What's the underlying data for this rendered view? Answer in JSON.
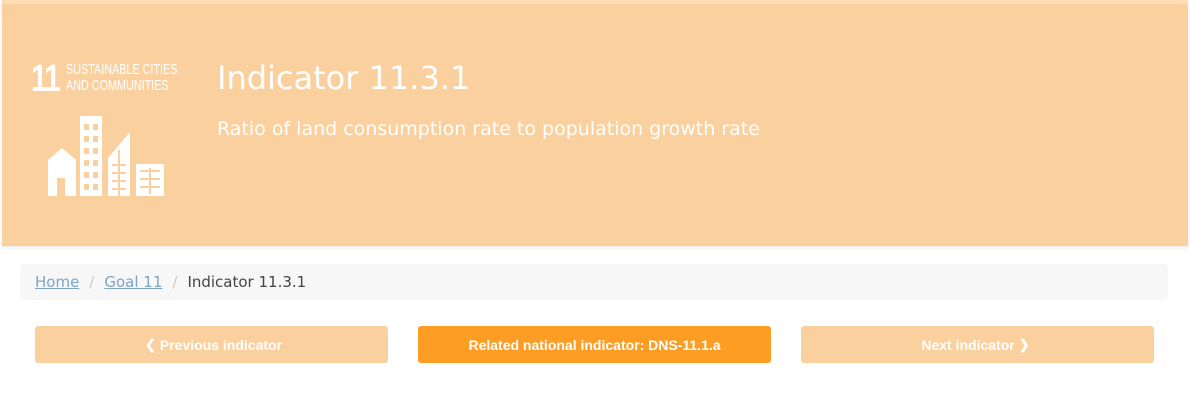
{
  "goal": {
    "number": "11",
    "title": "SUSTAINABLE CITIES\nAND COMMUNITIES",
    "icon": "city-buildings-icon"
  },
  "header": {
    "title": "Indicator 11.3.1",
    "subtitle": "Ratio of land consumption rate to population growth rate"
  },
  "breadcrumb": {
    "home": "Home",
    "goal": "Goal 11",
    "current": "Indicator 11.3.1",
    "separator": "/"
  },
  "nav": {
    "previous_label": "Previous indicator",
    "related_label": "Related national indicator: DNS-11.1.a",
    "next_label": "Next indicator",
    "previous_icon": "chevron-left-icon",
    "next_icon": "chevron-right-icon"
  },
  "colors": {
    "banner": "#fbd09f",
    "accent": "#fd9d24",
    "link": "#7ea4c8"
  }
}
